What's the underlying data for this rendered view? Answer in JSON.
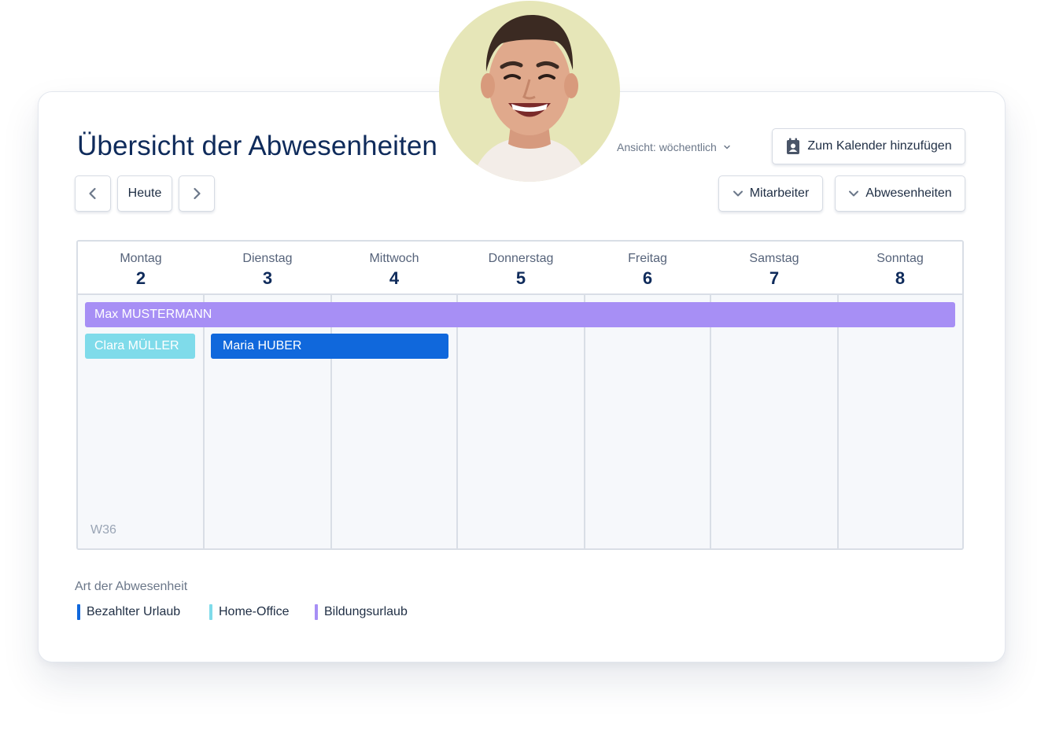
{
  "page": {
    "title": "Übersicht der Abwesenheiten",
    "view_select": "Ansicht: wöchentlich",
    "add_to_calendar": "Zum Kalender hinzufügen"
  },
  "nav": {
    "prev_icon": "chevron-left-icon",
    "today": "Heute",
    "next_icon": "chevron-right-icon"
  },
  "filters": {
    "employees": "Mitarbeiter",
    "absences": "Abwesenheiten"
  },
  "calendar": {
    "week_label": "W36",
    "days": [
      {
        "name": "Montag",
        "num": "2"
      },
      {
        "name": "Dienstag",
        "num": "3"
      },
      {
        "name": "Mittwoch",
        "num": "4"
      },
      {
        "name": "Donnerstag",
        "num": "5"
      },
      {
        "name": "Freitag",
        "num": "6"
      },
      {
        "name": "Samstag",
        "num": "7"
      },
      {
        "name": "Sonntag",
        "num": "8"
      }
    ],
    "events": [
      {
        "label": "Max MUSTERMANN",
        "type": "Bildungsurlaub",
        "color": "#a78ff5",
        "start_day": "Montag",
        "end_day": "Sonntag"
      },
      {
        "label": "Clara MÜLLER",
        "type": "Home-Office",
        "color": "#7fdbea",
        "start_day": "Montag",
        "end_day": "Montag"
      },
      {
        "label": "Maria HUBER",
        "type": "Bezahlter Urlaub",
        "color": "#1068dc",
        "start_day": "Dienstag",
        "end_day": "Mittwoch"
      }
    ]
  },
  "legend": {
    "title": "Art der Abwesenheit",
    "items": [
      {
        "label": "Bezahlter Urlaub",
        "color": "#1068dc"
      },
      {
        "label": "Home-Office",
        "color": "#7fdbea"
      },
      {
        "label": "Bildungsurlaub",
        "color": "#a78ff5"
      }
    ]
  },
  "avatar": {
    "icon": "user-avatar",
    "background": "#e6e6b8"
  }
}
